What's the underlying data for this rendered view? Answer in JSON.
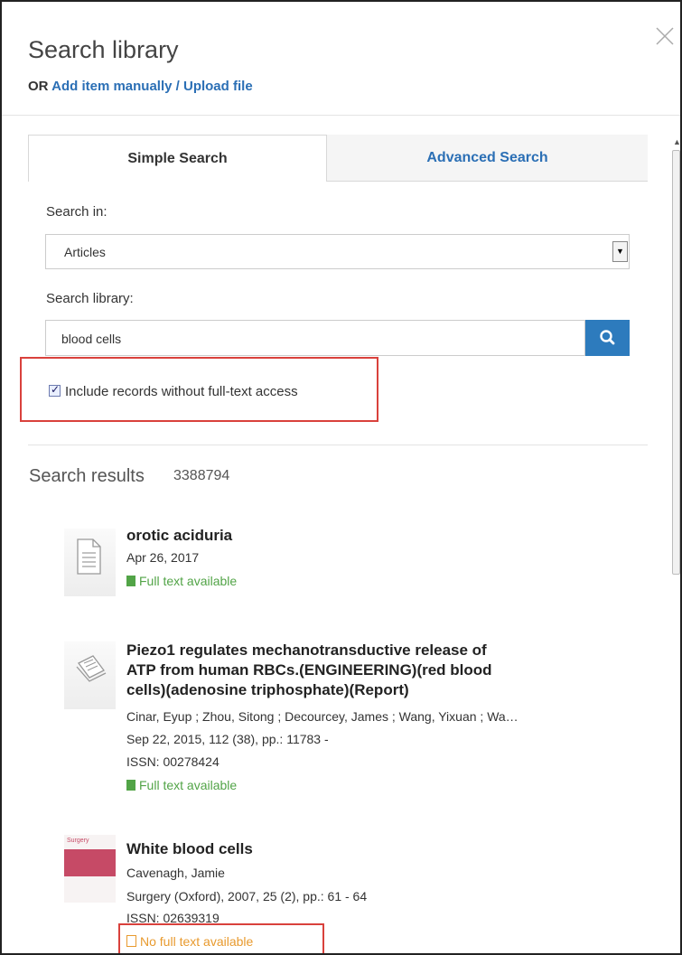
{
  "header": {
    "title": "Search library",
    "or_prefix": "OR",
    "add_link": "Add item manually / Upload file"
  },
  "tabs": {
    "simple": "Simple Search",
    "advanced": "Advanced Search"
  },
  "form": {
    "search_in_label": "Search in:",
    "search_in_value": "Articles",
    "search_library_label": "Search library:",
    "search_value": "blood cells",
    "include_checkbox_label": "Include records without full-text access",
    "include_checked": true
  },
  "results": {
    "title": "Search results",
    "count": "3388794",
    "items": [
      {
        "title": "orotic aciduria",
        "date": "Apr 26, 2017",
        "status": "Full text available"
      },
      {
        "title_line1": "Piezo1 regulates mechanotransductive release of",
        "title_line2": "ATP from human RBCs.(ENGINEERING)(red blood",
        "title_line3": "cells)(adenosine triphosphate)(Report)",
        "authors": "Cinar, Eyup ; Zhou, Sitong ; Decourcey, James ; Wang, Yixuan ; Wa…",
        "citation": "Sep 22, 2015,  112 (38),  pp.: 11783 -",
        "issn": "ISSN: 00278424",
        "status": "Full text available"
      },
      {
        "title": "White blood cells",
        "authors": "Cavenagh, Jamie",
        "citation": "Surgery (Oxford),  2007,  25 (2),  pp.: 61 - 64",
        "issn": "ISSN: 02639319",
        "status": "No full text available",
        "cover_text": "Surgery"
      }
    ]
  },
  "icons": {
    "close": "close-icon",
    "search": "search-icon",
    "dropdown": "chevron-down-icon"
  },
  "colors": {
    "link": "#2b6fb5",
    "search_button": "#2d7bbd",
    "full_text": "#52a447",
    "no_full_text": "#e89a2e",
    "highlight": "#d9413c"
  }
}
